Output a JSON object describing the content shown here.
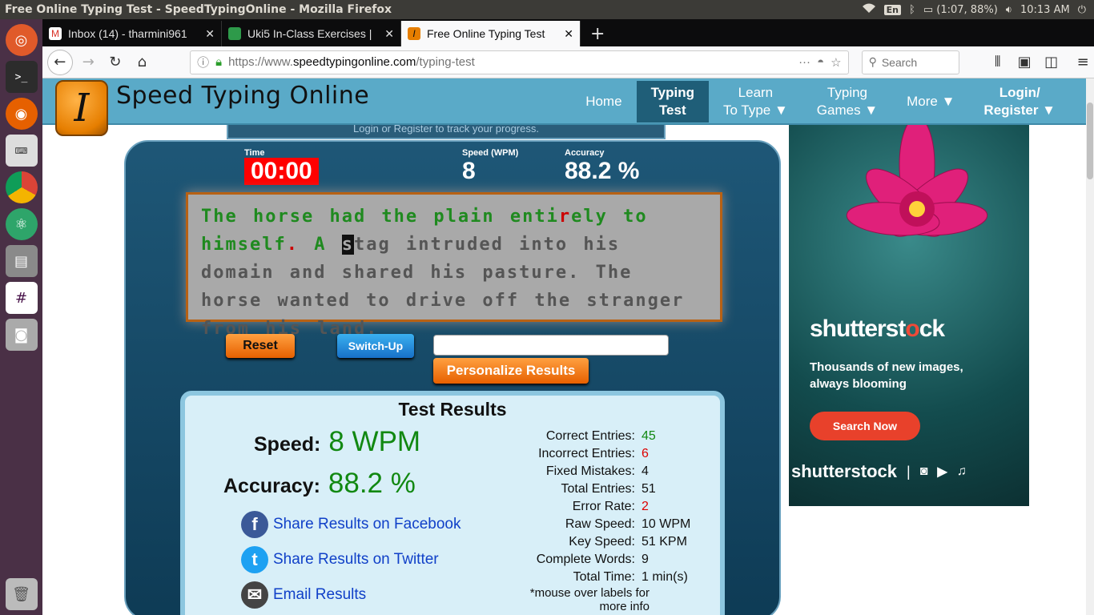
{
  "os": {
    "window_title": "Free Online Typing Test - SpeedTypingOnline - Mozilla Firefox",
    "lang": "En",
    "battery": "(1:07, 88%)",
    "clock": "10:13 AM"
  },
  "browser": {
    "tabs": [
      {
        "label": "Inbox (14) - tharmini961"
      },
      {
        "label": "Uki5 In-Class Exercises |"
      },
      {
        "label": "Free Online Typing Test"
      }
    ],
    "url_prefix": "https://www.",
    "url_domain": "speedtypingonline.com",
    "url_path": "/typing-test",
    "search_placeholder": "Search"
  },
  "site": {
    "logo_letter": "I",
    "name": "Speed Typing Online",
    "nav": {
      "home": "Home",
      "typing_test_1": "Typing",
      "typing_test_2": "Test",
      "learn_1": "Learn",
      "learn_2": "To Type ▼",
      "games_1": "Typing",
      "games_2": "Games ▼",
      "more": "More ▼",
      "login_1": "Login/",
      "login_2": "Register ▼"
    },
    "login_strip": "Login  or  Register  to track your progress."
  },
  "stats": {
    "time_label": "Time",
    "time": "00:00",
    "speed_label": "Speed (WPM)",
    "speed": "8",
    "accuracy_label": "Accuracy",
    "accuracy": "88.2 %"
  },
  "passage": {
    "typed_1": "The horse had the plain enti",
    "typed_err": "r",
    "typed_2": "ely to",
    "typed_3": "himself",
    "typed_err2": ".",
    "typed_4": " A ",
    "cursor": "s",
    "rest": "tag intruded into his domain and shared his pasture. The horse wanted to drive off the stranger from his land."
  },
  "controls": {
    "reset": "Reset",
    "switch_up": "Switch-Up",
    "personalize": "Personalize Results"
  },
  "results": {
    "title": "Test Results",
    "speed_label": "Speed:",
    "speed_value": "8 WPM",
    "accuracy_label": "Accuracy:",
    "accuracy_value": "88.2 %",
    "share_facebook": "Share Results on Facebook",
    "share_twitter": "Share Results on Twitter",
    "email": "Email Results",
    "details": [
      {
        "k": "Correct Entries:",
        "v": "45",
        "c": "green"
      },
      {
        "k": "Incorrect Entries:",
        "v": "6",
        "c": "red"
      },
      {
        "k": "Fixed Mistakes:",
        "v": "4",
        "c": ""
      },
      {
        "k": "Total Entries:",
        "v": "51",
        "c": ""
      },
      {
        "k": "Error Rate:",
        "v": "2",
        "c": "red"
      },
      {
        "k": "Raw Speed:",
        "v": "10 WPM",
        "c": ""
      },
      {
        "k": "Key Speed:",
        "v": "51 KPM",
        "c": ""
      },
      {
        "k": "Complete Words:",
        "v": "9",
        "c": ""
      },
      {
        "k": "Total Time:",
        "v": "1 min(s)",
        "c": ""
      }
    ],
    "note": "*mouse over labels for more info"
  },
  "ad": {
    "brand_a": "shutterst",
    "brand_o": "o",
    "brand_b": "ck",
    "tagline": "Thousands of new images, always blooming",
    "button": "Search Now",
    "footer_brand": "shutterstock"
  },
  "colors": {
    "accent_header": "#5aaac8",
    "time_bg": "#ff0000",
    "correct": "#118811",
    "error": "#dd0000"
  }
}
